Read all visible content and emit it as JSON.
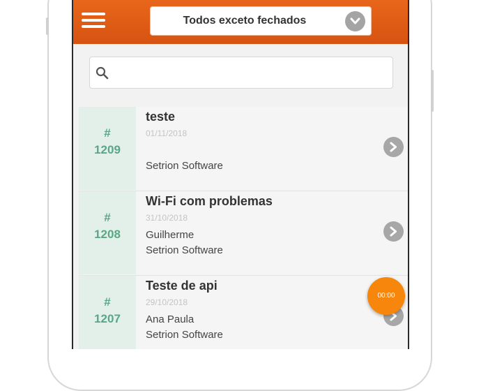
{
  "header": {
    "filter_value": "Todos exceto fechados"
  },
  "search": {
    "placeholder": "",
    "value": ""
  },
  "tickets": [
    {
      "hash": "#",
      "number": "1209",
      "title": "teste",
      "date": "01/11/2018",
      "person": "",
      "company": "Setrion Software"
    },
    {
      "hash": "#",
      "number": "1208",
      "title": "Wi-Fi com problemas",
      "date": "31/10/2018",
      "person": "Guilherme",
      "company": "Setrion Software"
    },
    {
      "hash": "#",
      "number": "1207",
      "title": "Teste de api",
      "date": "29/10/2018",
      "person": "Ana Paula",
      "company": "Setrion Software"
    }
  ],
  "timer": {
    "label": "00:00"
  },
  "icons": {
    "menu": "hamburger-icon",
    "filter": "chevron-down-icon",
    "search": "search-icon",
    "ticket_open": "chevron-right-icon"
  },
  "colors": {
    "header": "#e05c16",
    "ticket_number": "#5aa685",
    "ticket_number_bg": "#e3f0ea",
    "timer": "#f7860c"
  }
}
